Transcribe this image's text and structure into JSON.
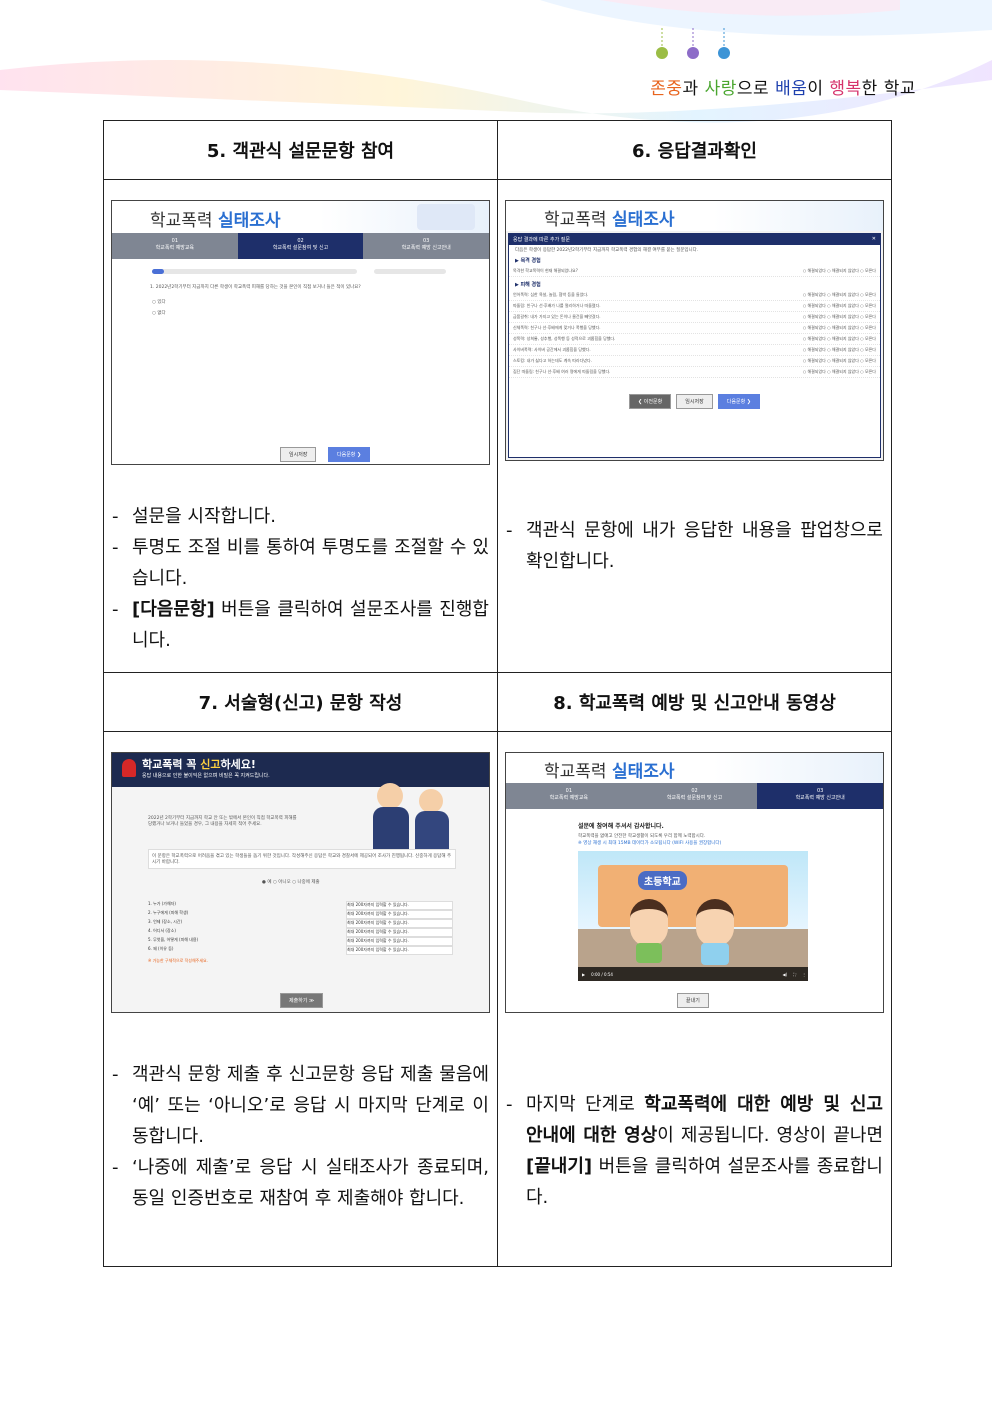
{
  "motto": {
    "w1": "존중",
    "p1": "과 ",
    "w2": "사랑",
    "p2": "으로 ",
    "w3": "배움",
    "p3": "이 ",
    "w4": "행복",
    "p4": "한 학교",
    "colors": {
      "w1": "#e8641e",
      "w2": "#4aa62f",
      "w3": "#1d3fae",
      "w4": "#d6336c"
    }
  },
  "cells": {
    "c5": {
      "header": "5. 객관식 설문문항 참여"
    },
    "c6": {
      "header": "6. 응답결과확인"
    },
    "c7": {
      "header": "7. 서술형(신고) 문항 작성"
    },
    "c8": {
      "header": "8. 학교폭력 예방 및 신고안내 동영상"
    }
  },
  "desc5": {
    "i1": "설문을 시작합니다.",
    "i2": "투명도 조절 비를 통하여 투명도를 조절할 수 있습니다.",
    "i3_bold": "[다음문항]",
    "i3_rest": " 버튼을 클릭하여 설문조사를 진행합니다."
  },
  "desc6": {
    "i1": "객관식 문항에 내가 응답한 내용을 팝업창으로 확인합니다."
  },
  "desc7": {
    "i1": "객관식 문항 제출 후 신고문항 응답 제출 물음에 ‘예’ 또는 ‘아니오’로 응답 시 마지막 단계로 이동합니다.",
    "i2": "‘나중에 제출’로 응답 시 실태조사가 종료되며, 동일 인증번호로 재참여 후 제출해야 합니다."
  },
  "desc8": {
    "a": "마지막 단계로 ",
    "b": "학교폭력에 대한 예방 및 신고 안내에 대한 영상",
    "c": "이 제공됩니다. 영상이 끝나면 ",
    "d": "[끝내기]",
    "e": " 버튼을 클릭하여 설문조사를 종료합니다."
  },
  "mini": {
    "title_a": "학교폭력 ",
    "title_b": "실태조사",
    "step1": "01",
    "step1_label": "학교폭력 예방교육",
    "step2": "02",
    "step2_label": "학교폭력 설문참여 및 신고",
    "step3": "03",
    "step3_label": "학교폭력 예방 신고안내",
    "btn_save": "임시저장",
    "btn_next": "다음문항 ❯",
    "btn_prev": "❮ 이전문항",
    "question": "1. 2022년2학기부터 지금까지 다른 학생이 학교폭력 피해를 당하는 것을 본인이 직접 보거나 들은 적이 있나요?",
    "opt_yes": "○ 있다",
    "opt_no": "○ 없다",
    "popup_title": "응답 결과에 따른 추가 질문",
    "popup_intro": "다음은 학생이 응답한 2022년2학기부터 지금까지 학교폭력 경험의 해결 여부를 묻는 질문입니다.",
    "popup_sec1": "▶ 목격 경험",
    "popup_sec2": "▶ 피해 경험",
    "popup_rows": [
      "목격한 학교폭력이 현재 해결되었나요?",
      "언어폭력: 심한 욕설, 놀림, 협박 등을 들었다.",
      "따돌림: 친구나 선·후배가 나를 멀리하거나 따돌렸다.",
      "금품갈취: 내가 가지고 있는 돈이나 물건을 빼앗겼다.",
      "신체폭력: 친구나 선·후배에게 맞거나 폭행을 당했다.",
      "성폭력: 성희롱, 성추행, 성폭행 등 성적으로 괴롭힘을 당했다.",
      "사이버폭력: 사이버 공간에서 괴롭힘을 당했다.",
      "스토킹: 내가 싫다고 하는데도 계속 따라다녔다.",
      "집단 따돌림: 친구나 선·후배 여러 명에게 따돌림을 당했다."
    ],
    "popup_opts": "○ 해결되었다  ○ 해결되지 않았다  ○ 모른다",
    "report_title_a": "학교폭력 꼭 ",
    "report_title_b": "신고",
    "report_title_c": "하세요!",
    "report_sub": "응답 내용으로 인한 불이익은 없으며 비밀은 꼭 지켜드립니다.",
    "report_q": "2022년 2학기부터 지금까지 학교 안 또는 밖에서 본인이 직접 학교폭력 피해를 당했거나 보거나 들었을 경우, 그 내용을 자세히 적어 주세요.",
    "report_notice": "이 문항은 학교폭력으로 어려움을 겪고 있는 학생들을 돕기 위한 것입니다. 작성해주신 응답은 학교와 경찰서에 제공되어 조사가 진행됩니다. 신중하게 응답해 주시기 바랍니다.",
    "report_radio": "● 예   ○ 아니오   ○ 나중에 제출",
    "report_fields": [
      "1. 누가 (가해자)",
      "2. 누구에게 (피해 학생)",
      "3. 언제 (장소, 시간)",
      "4. 어디서 (장소)",
      "5. 무엇을, 어떻게 (피해 내용)",
      "6. 왜 (이유 등)"
    ],
    "report_field_ph": "최대 200자까지 입력할 수 있습니다.",
    "report_warn": "※ 가능한 구체적으로 작성해주세요.",
    "report_submit": "제출하기 ≫",
    "video_thanks": "설문에 참여해 주셔서 감사합니다.",
    "video_sub1": "학교폭력을 없애고 안전한 학교생활이 되도록 우리 함께 노력합시다.",
    "video_sub2": "※ 영상 재생 시 최대 15MB 데이터가 소모됩니다 (WIFI 사용을 권장합니다)",
    "video_school": "초등학교",
    "video_time": "0:00 / 0:54",
    "btn_end": "끝내기"
  }
}
